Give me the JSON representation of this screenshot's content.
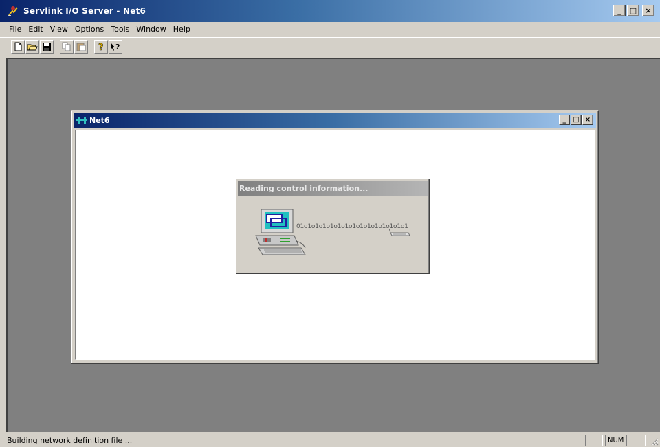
{
  "app": {
    "title": "Servlink I/O Server - Net6"
  },
  "window_controls": {
    "minimize": "_",
    "maximize": "□",
    "close": "×"
  },
  "menubar": {
    "items": [
      "File",
      "Edit",
      "View",
      "Options",
      "Tools",
      "Window",
      "Help"
    ]
  },
  "toolbar": {
    "buttons": [
      {
        "icon": "new-document-icon"
      },
      {
        "icon": "open-folder-icon"
      },
      {
        "icon": "save-icon"
      },
      {
        "icon": "copy-icon"
      },
      {
        "icon": "paste-icon"
      },
      {
        "icon": "about-icon"
      },
      {
        "icon": "context-help-icon"
      }
    ]
  },
  "child_window": {
    "title": "Net6",
    "icon": "network-icon"
  },
  "progress_dialog": {
    "title": "Reading control information...",
    "binary_stream": "01o1o1o1o1o1o1o1o1o1o1o1o1o1o1"
  },
  "statusbar": {
    "message": "Building network definition file ...",
    "num_indicator": "NUM"
  },
  "colors": {
    "title_active_start": "#0a246a",
    "title_active_end": "#a6caf0",
    "face": "#d4d0c8",
    "mdi_background": "#808080"
  }
}
